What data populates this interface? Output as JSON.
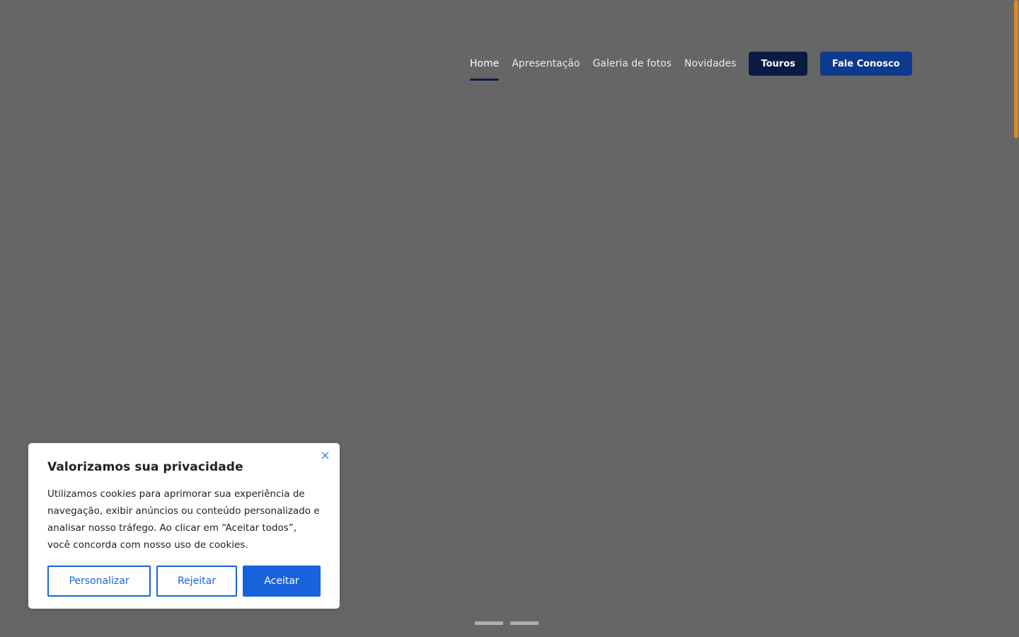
{
  "nav": {
    "links": [
      {
        "label": "Home",
        "active": true
      },
      {
        "label": "Apresentação",
        "active": false
      },
      {
        "label": "Galeria de fotos",
        "active": false
      },
      {
        "label": "Novidades",
        "active": false
      }
    ],
    "touros_label": "Touros",
    "fale_label": "Fale Conosco"
  },
  "cookie": {
    "title": "Valorizamos sua privacidade",
    "text": "Utilizamos cookies para aprimorar sua experiência de navegação, exibir anúncios ou conteúdo personalizado e analisar nosso tráfego. Ao clicar em “Aceitar todos”, você concorda com nosso uso de cookies.",
    "customize_label": "Personalizar",
    "reject_label": "Rejeitar",
    "accept_label": "Aceitar",
    "close_icon": "close-icon"
  },
  "slider": {
    "slide_count": 2
  },
  "colors": {
    "background": "#666666",
    "nav_active_underline": "#0c1e4f",
    "touros_button": "#0a1a45",
    "fale_button": "#0d3a8c",
    "cookie_accent": "#1863dc",
    "scrollbar_thumb": "#d98a2b"
  }
}
